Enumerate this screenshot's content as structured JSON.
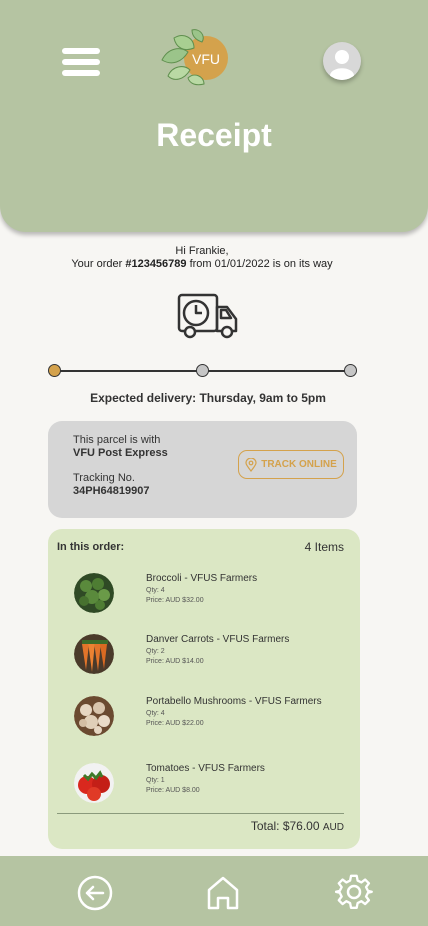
{
  "header": {
    "title": "Receipt",
    "logo_text": "VFU"
  },
  "greeting": {
    "line1": "Hi Frankie,",
    "prefix": "Your order ",
    "order_number": "#123456789",
    "suffix": " from 01/01/2022 is on its way"
  },
  "progress": {
    "steps": 3,
    "current_step": 1
  },
  "expected_delivery": "Expected delivery: Thursday, 9am to 5pm",
  "parcel": {
    "with_label": "This parcel is with",
    "carrier": "VFU Post Express",
    "tracking_label": "Tracking No.",
    "tracking_number": "34PH64819907",
    "track_button": "TRACK ONLINE"
  },
  "order": {
    "heading": "In this order:",
    "count": "4 Items",
    "items": [
      {
        "name": "Broccoli - VFUS Farmers",
        "qty": "Qty: 4",
        "price": "Price: AUD $32.00"
      },
      {
        "name": "Danver Carrots - VFUS Farmers",
        "qty": "Qty: 2",
        "price": "Price: AUD $14.00"
      },
      {
        "name": "Portabello Mushrooms - VFUS Farmers",
        "qty": "Qty: 4",
        "price": "Price: AUD $22.00"
      },
      {
        "name": "Tomatoes - VFUS Farmers",
        "qty": "Qty: 1",
        "price": "Price: AUD $8.00"
      }
    ],
    "total_label": "Total: $76.00",
    "total_currency": "AUD"
  },
  "icons": {
    "menu": "menu-icon",
    "avatar": "user-avatar-icon",
    "truck": "delivery-truck-icon",
    "track": "location-pin-icon",
    "back": "back-arrow-icon",
    "home": "home-icon",
    "settings": "gear-icon"
  },
  "colors": {
    "header_bg": "#b5c4a2",
    "background": "#f7f6f3",
    "accent_orange": "#d4a24c",
    "parcel_card": "#d6d6d6",
    "order_card": "#dbe7c4"
  }
}
